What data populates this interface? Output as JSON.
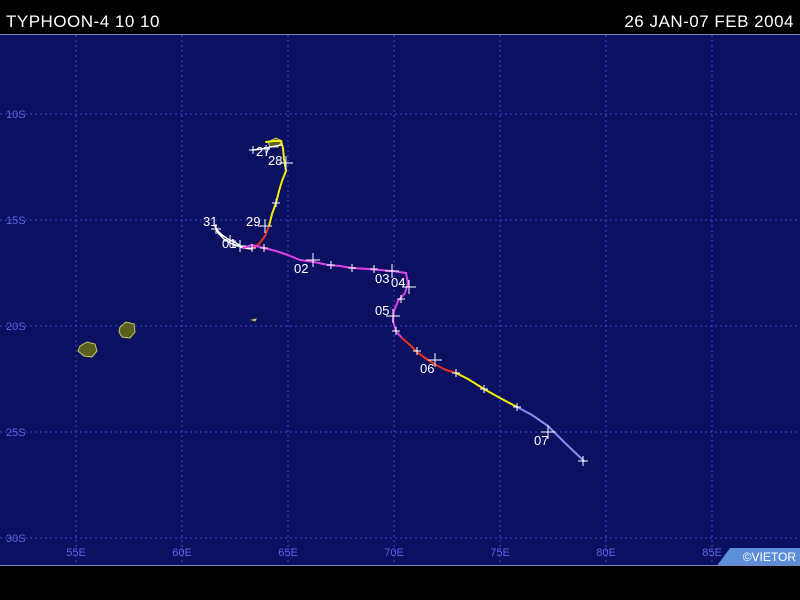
{
  "header": {
    "title": "TYPHOON-4 10 10",
    "date_range": "26 JAN-07 FEB 2004"
  },
  "map": {
    "background_color": "#0b1060",
    "grid_color": "#3c46d8",
    "label_color": "#5a64e6",
    "lon_labels": [
      "55E",
      "60E",
      "65E",
      "70E",
      "75E",
      "80E",
      "85E"
    ],
    "lat_labels": [
      "10S",
      "15S",
      "20S",
      "25S",
      "30S"
    ],
    "copyright": "©VIETOR"
  },
  "track": {
    "colors": {
      "yellow": "#f4f000",
      "red": "#e8331c",
      "magenta": "#e040e8",
      "periwinkle": "#8a8ef0",
      "white": "#ffffff"
    },
    "day_labels": [
      "27",
      "28",
      "29",
      "31",
      "01",
      "02",
      "03",
      "04",
      "05",
      "06",
      "07"
    ]
  }
}
